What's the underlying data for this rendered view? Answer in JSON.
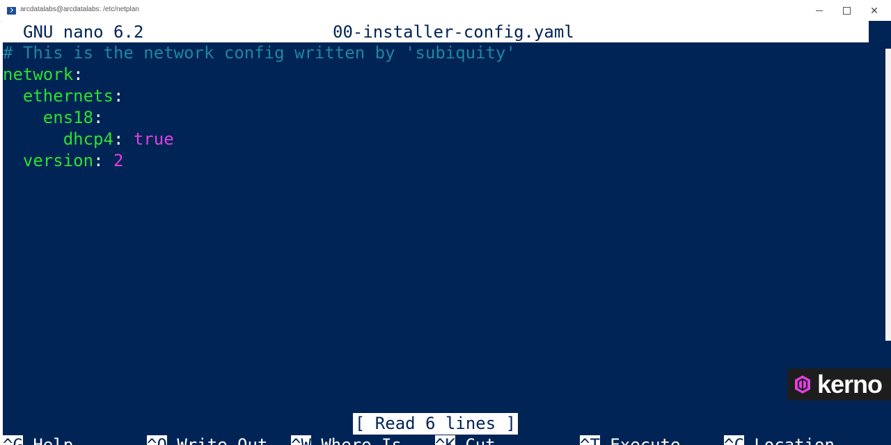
{
  "window": {
    "title": "arcdatalabs@arcdatalabs: /etc/netplan",
    "icon": "powershell-icon"
  },
  "nano": {
    "version": "GNU nano 6.2",
    "filename": "00-installer-config.yaml",
    "lines": [
      {
        "comment": "# This is the network config written by 'subiquity'"
      },
      {
        "key": "network",
        "sep": ":"
      },
      {
        "indent": "  ",
        "key": "ethernets",
        "sep": ":"
      },
      {
        "indent": "    ",
        "key": "ens18",
        "sep": ":"
      },
      {
        "indent": "      ",
        "key": "dhcp4",
        "sep": ": ",
        "value": "true"
      },
      {
        "indent": "  ",
        "key": "version",
        "sep": ": ",
        "value": "2"
      }
    ],
    "status": "[ Read 6 lines ]",
    "shortcuts": [
      {
        "key": "^G",
        "label": "Help"
      },
      {
        "key": "^O",
        "label": "Write Out"
      },
      {
        "key": "^W",
        "label": "Where Is"
      },
      {
        "key": "^K",
        "label": "Cut"
      },
      {
        "key": "^T",
        "label": "Execute"
      },
      {
        "key": "^C",
        "label": "Location"
      }
    ]
  },
  "watermark": {
    "text": "kerno",
    "color": "#e040e0"
  },
  "colors": {
    "background": "#012456",
    "comment": "#1f86a0",
    "key": "#2ee02e",
    "value": "#e040e0"
  }
}
